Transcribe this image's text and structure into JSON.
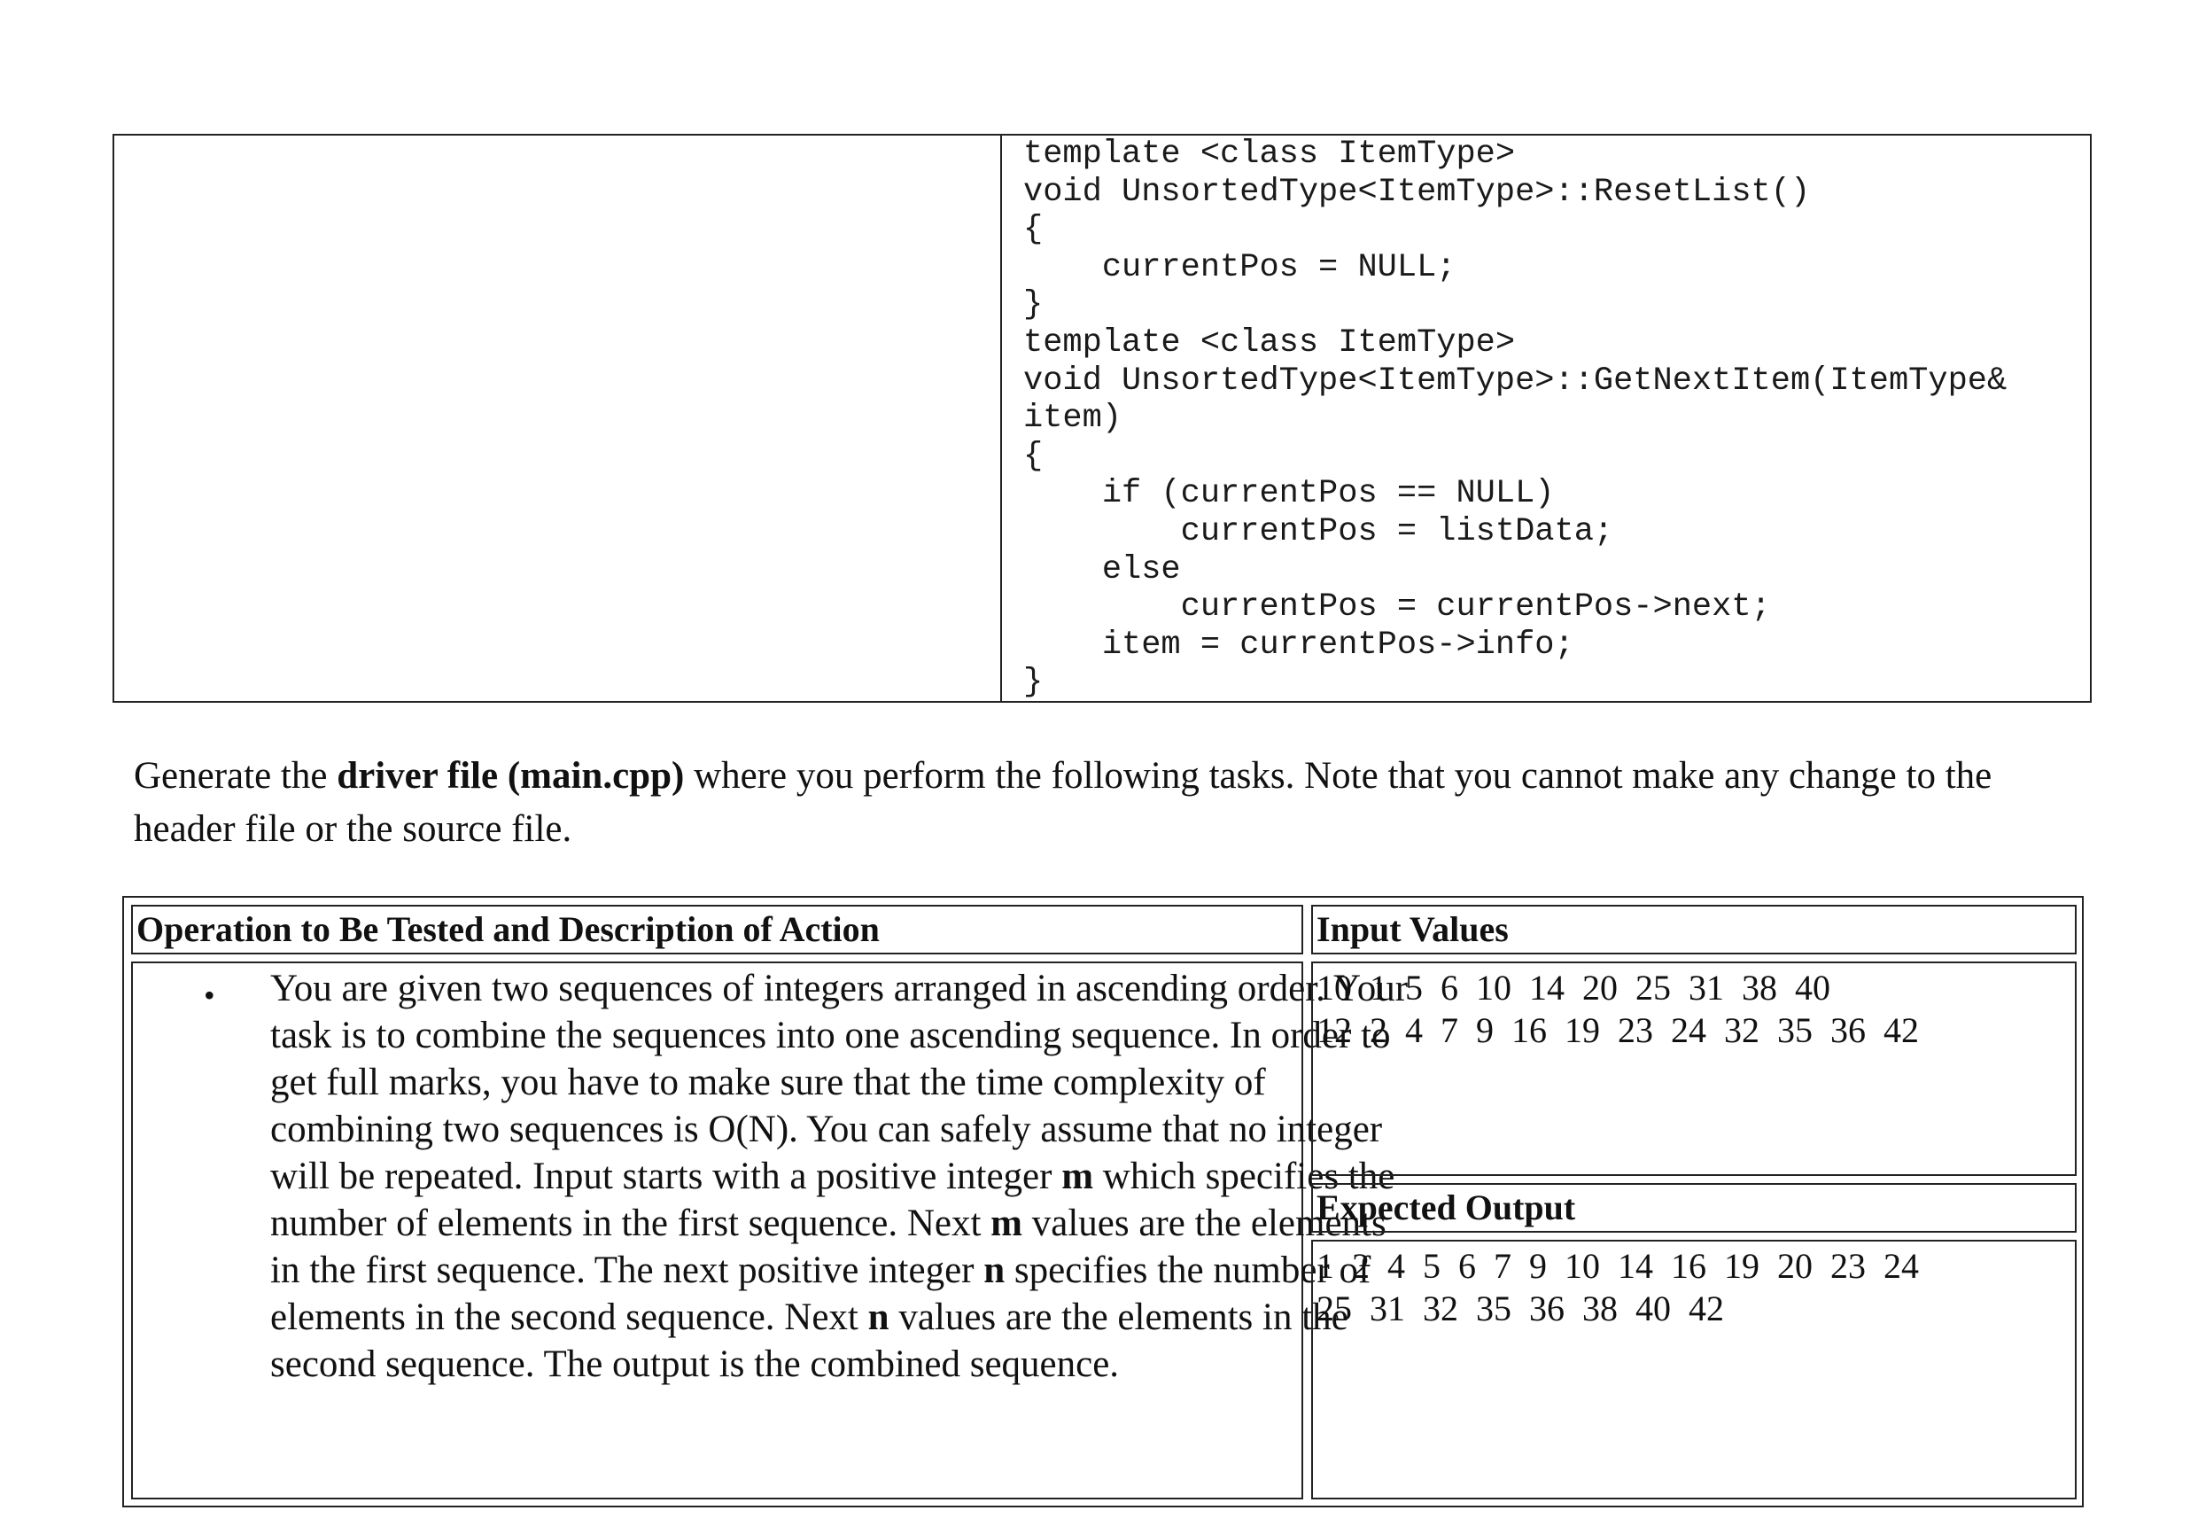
{
  "code": {
    "lines": [
      "template <class ItemType>",
      "void UnsortedType<ItemType>::ResetList()",
      "{",
      "    currentPos = NULL;",
      "}",
      "template <class ItemType>",
      "void UnsortedType<ItemType>::GetNextItem(ItemType&",
      "item)",
      "{",
      "    if (currentPos == NULL)",
      "        currentPos = listData;",
      "    else",
      "        currentPos = currentPos->next;",
      "    item = currentPos->info;",
      "}"
    ]
  },
  "instructions": {
    "part1": "Generate the ",
    "bold": "driver file (main.cpp)",
    "part2": " where you perform the following tasks. Note that you cannot make any change to the header file or the source file."
  },
  "table": {
    "header_operation": "Operation to Be Tested and Description of Action",
    "header_input": "Input Values",
    "header_output": "Expected Output",
    "bullet": "•",
    "description": {
      "t1": "You are given two sequences of integers arranged in ascending order. Your task is to combine the sequences into one ascending sequence. In order to get full marks, you have to make sure that the time complexity of combining two sequences is O(N). You can safely assume that no integer will be repeated. Input starts with a positive integer ",
      "m1": "m",
      "t2": " which specifies the number of elements in the first sequence. Next ",
      "m2": "m",
      "t3": " values are the elements in the first sequence. The next positive integer ",
      "n1": "n",
      "t4": " specifies the number of elements in the second sequence. Next ",
      "n2": "n",
      "t5": " values are the elements in the second sequence. The output is the combined sequence."
    },
    "input_lines": [
      "10  1  5  6  10  14  20  25  31  38  40",
      "12  2  4  7  9  16  19  23  24  32  35  36  42"
    ],
    "output_lines": [
      "1  2  4  5  6  7  9  10  14  16  19  20  23  24",
      "25  31  32  35  36  38  40  42"
    ]
  }
}
